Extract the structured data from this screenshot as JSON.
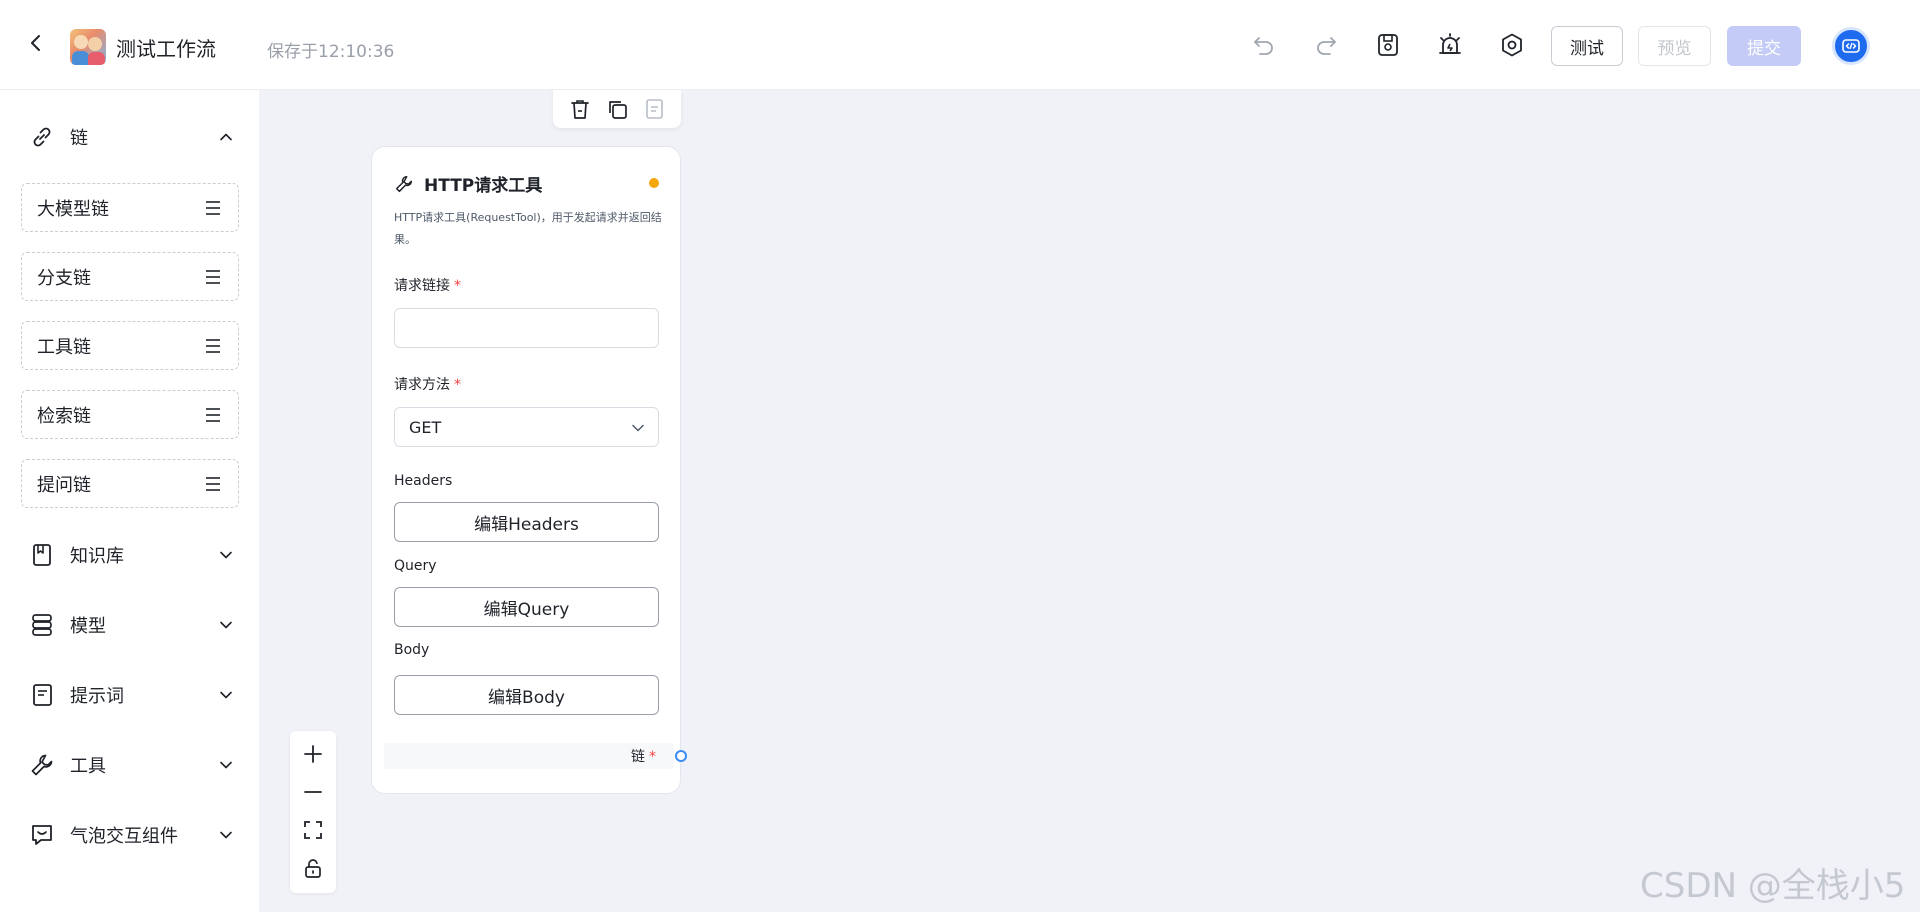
{
  "header": {
    "title": "测试工作流",
    "save_status": "保存于12:10:36",
    "buttons": {
      "test": "测试",
      "preview": "预览",
      "submit": "提交"
    }
  },
  "sidebar": {
    "chain_group": {
      "label": "链",
      "expanded": true,
      "items": [
        {
          "label": "大模型链"
        },
        {
          "label": "分支链"
        },
        {
          "label": "工具链"
        },
        {
          "label": "检索链"
        },
        {
          "label": "提问链"
        }
      ]
    },
    "groups": [
      {
        "label": "知识库",
        "icon": "book-icon"
      },
      {
        "label": "模型",
        "icon": "database-icon"
      },
      {
        "label": "提示词",
        "icon": "prompt-doc-icon"
      },
      {
        "label": "工具",
        "icon": "wrench-icon"
      },
      {
        "label": "气泡交互组件",
        "icon": "chat-bubble-icon"
      }
    ]
  },
  "node": {
    "title": "HTTP请求工具",
    "description": "HTTP请求工具(RequestTool)，用于发起请求并返回结果。",
    "status_color": "#f5a60a",
    "fields": {
      "url_label": "请求链接",
      "url_value": "",
      "method_label": "请求方法",
      "method_value": "GET",
      "headers_label": "Headers",
      "headers_button": "编辑Headers",
      "query_label": "Query",
      "query_button": "编辑Query",
      "body_label": "Body",
      "body_button": "编辑Body"
    },
    "required_mark": "*",
    "output_label": "链"
  },
  "watermark": "CSDN @全栈小5",
  "colors": {
    "accent": "#1f6bf0",
    "submit_disabled": "#c5cbf7",
    "required": "#f53f3f",
    "handle": "#3b8cf5"
  }
}
